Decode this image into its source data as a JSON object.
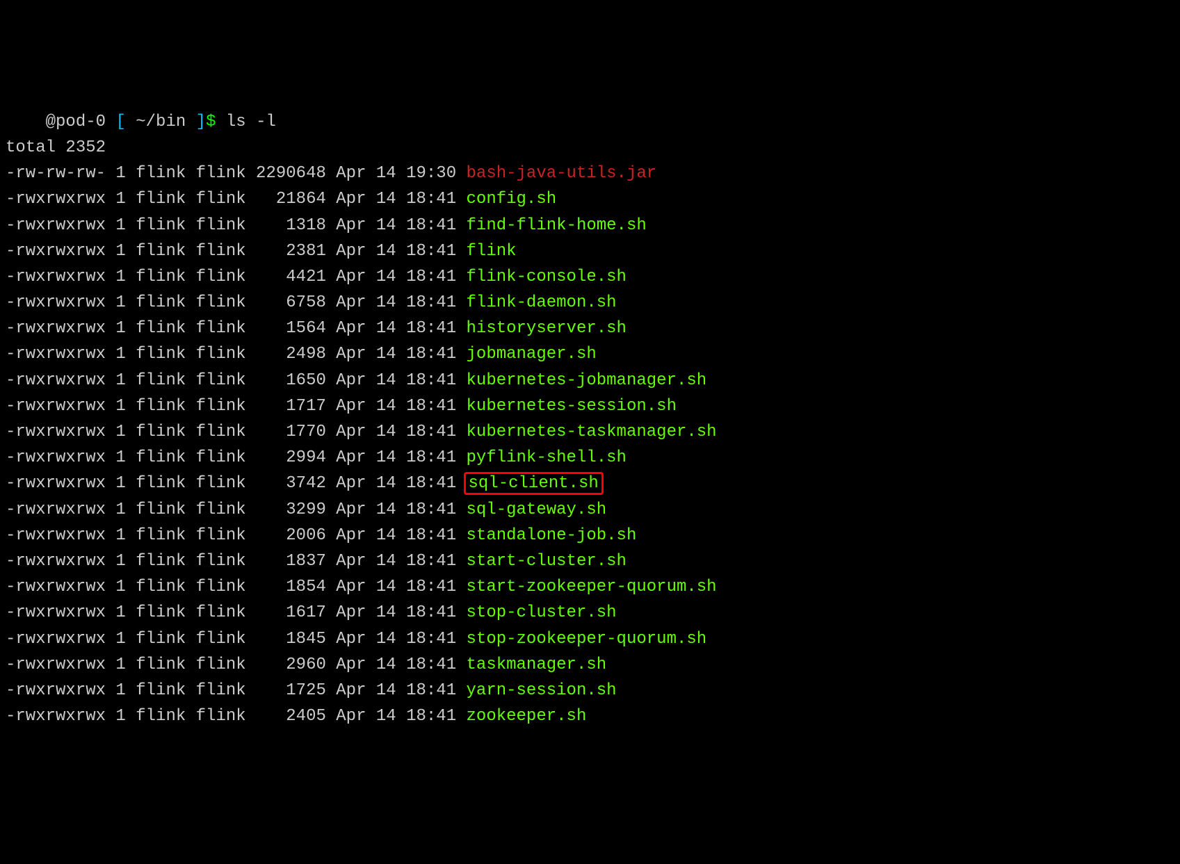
{
  "prompt": {
    "user_host": "@pod-0",
    "open_bracket": "[",
    "path": "~/bin",
    "close_bracket": "]",
    "dollar": "$",
    "command": "ls -l"
  },
  "total": "total 2352",
  "rows": [
    {
      "perms": "-rw-rw-rw-",
      "links": "1",
      "owner": "flink",
      "group": "flink",
      "size": "2290648",
      "month": "Apr",
      "day": "14",
      "time": "19:30",
      "name": "bash-java-utils.jar",
      "type": "regular",
      "highlight": false
    },
    {
      "perms": "-rwxrwxrwx",
      "links": "1",
      "owner": "flink",
      "group": "flink",
      "size": "21864",
      "month": "Apr",
      "day": "14",
      "time": "18:41",
      "name": "config.sh",
      "type": "exec",
      "highlight": false
    },
    {
      "perms": "-rwxrwxrwx",
      "links": "1",
      "owner": "flink",
      "group": "flink",
      "size": "1318",
      "month": "Apr",
      "day": "14",
      "time": "18:41",
      "name": "find-flink-home.sh",
      "type": "exec",
      "highlight": false
    },
    {
      "perms": "-rwxrwxrwx",
      "links": "1",
      "owner": "flink",
      "group": "flink",
      "size": "2381",
      "month": "Apr",
      "day": "14",
      "time": "18:41",
      "name": "flink",
      "type": "exec",
      "highlight": false
    },
    {
      "perms": "-rwxrwxrwx",
      "links": "1",
      "owner": "flink",
      "group": "flink",
      "size": "4421",
      "month": "Apr",
      "day": "14",
      "time": "18:41",
      "name": "flink-console.sh",
      "type": "exec",
      "highlight": false
    },
    {
      "perms": "-rwxrwxrwx",
      "links": "1",
      "owner": "flink",
      "group": "flink",
      "size": "6758",
      "month": "Apr",
      "day": "14",
      "time": "18:41",
      "name": "flink-daemon.sh",
      "type": "exec",
      "highlight": false
    },
    {
      "perms": "-rwxrwxrwx",
      "links": "1",
      "owner": "flink",
      "group": "flink",
      "size": "1564",
      "month": "Apr",
      "day": "14",
      "time": "18:41",
      "name": "historyserver.sh",
      "type": "exec",
      "highlight": false
    },
    {
      "perms": "-rwxrwxrwx",
      "links": "1",
      "owner": "flink",
      "group": "flink",
      "size": "2498",
      "month": "Apr",
      "day": "14",
      "time": "18:41",
      "name": "jobmanager.sh",
      "type": "exec",
      "highlight": false
    },
    {
      "perms": "-rwxrwxrwx",
      "links": "1",
      "owner": "flink",
      "group": "flink",
      "size": "1650",
      "month": "Apr",
      "day": "14",
      "time": "18:41",
      "name": "kubernetes-jobmanager.sh",
      "type": "exec",
      "highlight": false
    },
    {
      "perms": "-rwxrwxrwx",
      "links": "1",
      "owner": "flink",
      "group": "flink",
      "size": "1717",
      "month": "Apr",
      "day": "14",
      "time": "18:41",
      "name": "kubernetes-session.sh",
      "type": "exec",
      "highlight": false
    },
    {
      "perms": "-rwxrwxrwx",
      "links": "1",
      "owner": "flink",
      "group": "flink",
      "size": "1770",
      "month": "Apr",
      "day": "14",
      "time": "18:41",
      "name": "kubernetes-taskmanager.sh",
      "type": "exec",
      "highlight": false
    },
    {
      "perms": "-rwxrwxrwx",
      "links": "1",
      "owner": "flink",
      "group": "flink",
      "size": "2994",
      "month": "Apr",
      "day": "14",
      "time": "18:41",
      "name": "pyflink-shell.sh",
      "type": "exec",
      "highlight": false
    },
    {
      "perms": "-rwxrwxrwx",
      "links": "1",
      "owner": "flink",
      "group": "flink",
      "size": "3742",
      "month": "Apr",
      "day": "14",
      "time": "18:41",
      "name": "sql-client.sh",
      "type": "exec",
      "highlight": true
    },
    {
      "perms": "-rwxrwxrwx",
      "links": "1",
      "owner": "flink",
      "group": "flink",
      "size": "3299",
      "month": "Apr",
      "day": "14",
      "time": "18:41",
      "name": "sql-gateway.sh",
      "type": "exec",
      "highlight": false
    },
    {
      "perms": "-rwxrwxrwx",
      "links": "1",
      "owner": "flink",
      "group": "flink",
      "size": "2006",
      "month": "Apr",
      "day": "14",
      "time": "18:41",
      "name": "standalone-job.sh",
      "type": "exec",
      "highlight": false
    },
    {
      "perms": "-rwxrwxrwx",
      "links": "1",
      "owner": "flink",
      "group": "flink",
      "size": "1837",
      "month": "Apr",
      "day": "14",
      "time": "18:41",
      "name": "start-cluster.sh",
      "type": "exec",
      "highlight": false
    },
    {
      "perms": "-rwxrwxrwx",
      "links": "1",
      "owner": "flink",
      "group": "flink",
      "size": "1854",
      "month": "Apr",
      "day": "14",
      "time": "18:41",
      "name": "start-zookeeper-quorum.sh",
      "type": "exec",
      "highlight": false
    },
    {
      "perms": "-rwxrwxrwx",
      "links": "1",
      "owner": "flink",
      "group": "flink",
      "size": "1617",
      "month": "Apr",
      "day": "14",
      "time": "18:41",
      "name": "stop-cluster.sh",
      "type": "exec",
      "highlight": false
    },
    {
      "perms": "-rwxrwxrwx",
      "links": "1",
      "owner": "flink",
      "group": "flink",
      "size": "1845",
      "month": "Apr",
      "day": "14",
      "time": "18:41",
      "name": "stop-zookeeper-quorum.sh",
      "type": "exec",
      "highlight": false
    },
    {
      "perms": "-rwxrwxrwx",
      "links": "1",
      "owner": "flink",
      "group": "flink",
      "size": "2960",
      "month": "Apr",
      "day": "14",
      "time": "18:41",
      "name": "taskmanager.sh",
      "type": "exec",
      "highlight": false
    },
    {
      "perms": "-rwxrwxrwx",
      "links": "1",
      "owner": "flink",
      "group": "flink",
      "size": "1725",
      "month": "Apr",
      "day": "14",
      "time": "18:41",
      "name": "yarn-session.sh",
      "type": "exec",
      "highlight": false
    },
    {
      "perms": "-rwxrwxrwx",
      "links": "1",
      "owner": "flink",
      "group": "flink",
      "size": "2405",
      "month": "Apr",
      "day": "14",
      "time": "18:41",
      "name": "zookeeper.sh",
      "type": "exec",
      "highlight": false
    }
  ]
}
